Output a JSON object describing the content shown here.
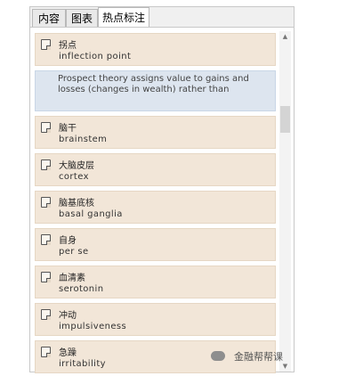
{
  "tabs": [
    {
      "label": "内容"
    },
    {
      "label": "图表"
    },
    {
      "label": "热点标注"
    }
  ],
  "notes": [
    {
      "title": "拐点",
      "subtitle": "inflection point"
    },
    {
      "text": "Prospect theory assigns value to gains and losses (changes in wealth) rather than"
    },
    {
      "title": "脑干",
      "subtitle": "brainstem"
    },
    {
      "title": "大脑皮层",
      "subtitle": "cortex"
    },
    {
      "title": "脑基底核",
      "subtitle": "basal ganglia"
    },
    {
      "title": "自身",
      "subtitle": "per se"
    },
    {
      "title": "血清素",
      "subtitle": "serotonin"
    },
    {
      "title": "冲动",
      "subtitle": "impulsiveness"
    },
    {
      "title": "急躁",
      "subtitle": "irritability"
    }
  ],
  "scrollbar": {
    "up": "▲",
    "down": "▼"
  },
  "watermark": {
    "text": "金融帮帮课",
    "icon": "wechat-icon"
  },
  "colors": {
    "note_bg": "#f2e6d8",
    "highlight_bg": "#dde5ef"
  }
}
